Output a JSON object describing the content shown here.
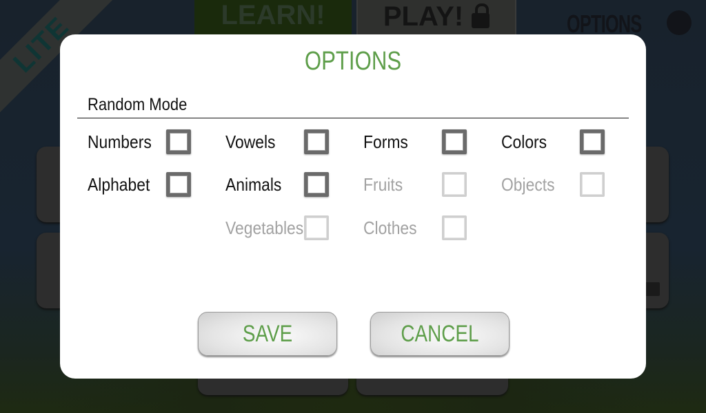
{
  "background": {
    "ribbon_label": "LITE",
    "learn_button": "LEARN!",
    "play_button": "PLAY!",
    "options_button": "OPTIONS"
  },
  "dialog": {
    "title": "OPTIONS",
    "section_label": "Random Mode",
    "options": [
      {
        "label": "Numbers",
        "checked": false,
        "enabled": true
      },
      {
        "label": "Vowels",
        "checked": false,
        "enabled": true
      },
      {
        "label": "Forms",
        "checked": false,
        "enabled": true
      },
      {
        "label": "Colors",
        "checked": false,
        "enabled": true
      },
      {
        "label": "Alphabet",
        "checked": false,
        "enabled": true
      },
      {
        "label": "Animals",
        "checked": false,
        "enabled": true
      },
      {
        "label": "Fruits",
        "checked": false,
        "enabled": false
      },
      {
        "label": "Objects",
        "checked": false,
        "enabled": false
      },
      {
        "label": "Vegetables",
        "checked": false,
        "enabled": false
      },
      {
        "label": "Clothes",
        "checked": false,
        "enabled": false
      }
    ],
    "save_label": "SAVE",
    "cancel_label": "CANCEL"
  },
  "colors": {
    "accent_green": "#5e9e4a",
    "disabled_text": "#a2a2a2"
  }
}
